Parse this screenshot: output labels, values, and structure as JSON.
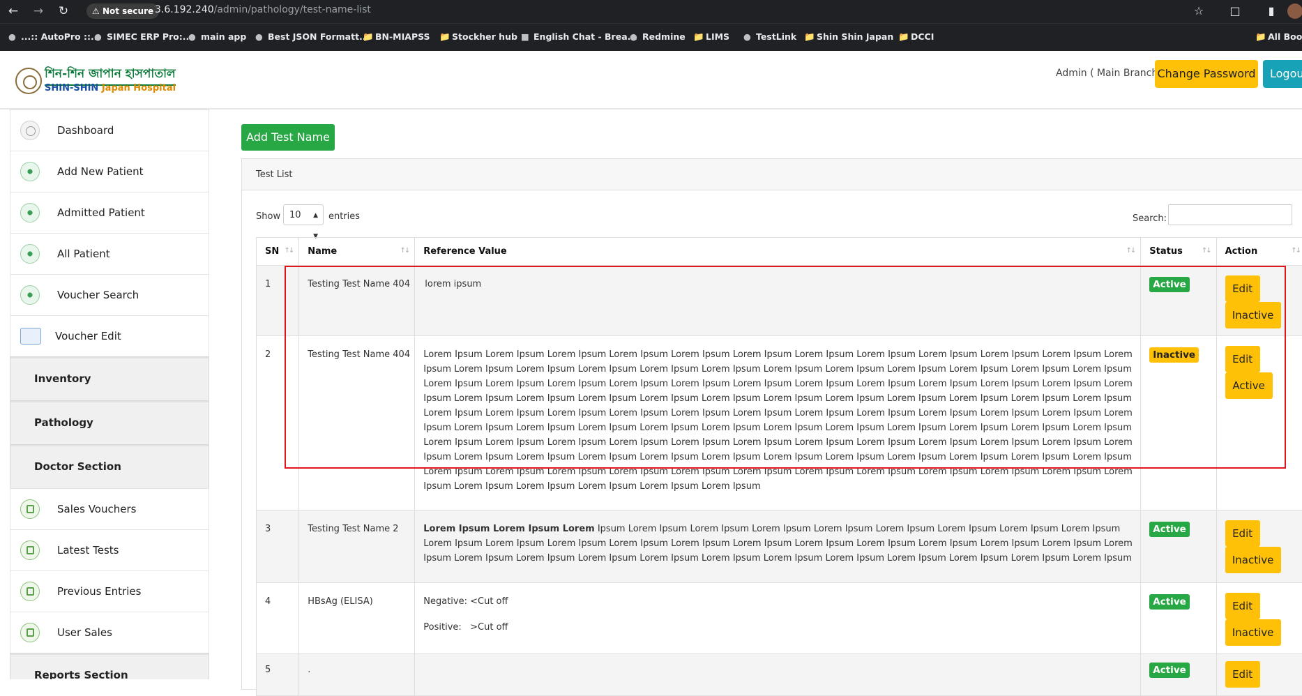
{
  "browser": {
    "secure_chip": "Not secure",
    "url_host": "3.6.192.240",
    "url_path": "/admin/pathology/test-name-list",
    "bookmarks": [
      "...:: AutoPro ::...",
      "SIMEC ERP Pro:...",
      "main app",
      "Best JSON Formatt...",
      "BN-MIAPSS",
      "Stockher hub",
      "English Chat - Brea...",
      "Redmine",
      "LIMS",
      "TestLink",
      "Shin Shin Japan",
      "DCCI",
      "All Boo"
    ]
  },
  "header": {
    "logo_bn": "শিন-শিন জাপান হাসপাতাল",
    "logo_en_a": "SHIN-SHIN ",
    "logo_en_b": "Japan Hospital",
    "admin_label": "Admin ( Main Branch )",
    "change_password": "Change Password",
    "logout": "Logou"
  },
  "sidebar": {
    "items": [
      {
        "label": "Dashboard"
      },
      {
        "label": "Add New Patient"
      },
      {
        "label": "Admitted Patient"
      },
      {
        "label": "All Patient"
      },
      {
        "label": "Voucher Search"
      },
      {
        "label": "Voucher Edit"
      }
    ],
    "sections": [
      "Inventory",
      "Pathology",
      "Doctor Section"
    ],
    "items2": [
      {
        "label": "Sales Vouchers"
      },
      {
        "label": "Latest Tests"
      },
      {
        "label": "Previous Entries"
      },
      {
        "label": "User Sales"
      }
    ],
    "reports": "Reports Section"
  },
  "main": {
    "add_button": "Add Test Name",
    "card_title": "Test List",
    "show": "Show",
    "show_value": "10",
    "entries": "entries",
    "search_label": "Search:",
    "columns": [
      "SN",
      "Name",
      "Reference Value",
      "Status",
      "Action"
    ],
    "rows": [
      {
        "sn": "1",
        "name": "Testing Test Name 404",
        "ref": "lorem ipsum",
        "status": "Active",
        "edit": "Edit",
        "toggle": "Inactive"
      },
      {
        "sn": "2",
        "name": "Testing Test Name 404",
        "ref": "Lorem Ipsum Lorem Ipsum Lorem Ipsum Lorem Ipsum  Lorem Ipsum Lorem Ipsum Lorem Ipsum Lorem Ipsum  Lorem Ipsum Lorem Ipsum Lorem Ipsum Lorem Ipsum  Lorem Ipsum Lorem Ipsum Lorem Ipsum Lorem Ipsum  Lorem Ipsum Lorem Ipsum Lorem Ipsum Lorem Ipsum  Lorem Ipsum Lorem Ipsum Lorem Ipsum Lorem Ipsum  Lorem Ipsum Lorem Ipsum Lorem Ipsum Lorem Ipsum  Lorem Ipsum Lorem Ipsum Lorem Ipsum Lorem Ipsum  Lorem Ipsum Lorem Ipsum Lorem Ipsum Lorem Ipsum  Lorem Ipsum Lorem Ipsum Lorem Ipsum Lorem Ipsum  Lorem Ipsum Lorem Ipsum Lorem Ipsum Lorem Ipsum  Lorem Ipsum Lorem Ipsum Lorem Ipsum Lorem Ipsum  Lorem Ipsum Lorem Ipsum Lorem Ipsum Lorem Ipsum  Lorem Ipsum Lorem Ipsum Lorem Ipsum Lorem Ipsum  Lorem Ipsum Lorem Ipsum Lorem Ipsum Lorem Ipsum  Lorem Ipsum Lorem Ipsum Lorem Ipsum Lorem Ipsum  Lorem Ipsum Lorem Ipsum Lorem Ipsum Lorem Ipsum  Lorem Ipsum Lorem Ipsum Lorem Ipsum Lorem Ipsum  Lorem Ipsum Lorem Ipsum Lorem Ipsum Lorem Ipsum  Lorem Ipsum Lorem Ipsum Lorem Ipsum Lorem Ipsum  Lorem Ipsum Lorem Ipsum Lorem Ipsum Lorem Ipsum  Lorem Ipsum Lorem Ipsum Lorem Ipsum Lorem Ipsum  Lorem Ipsum Lorem Ipsum Lorem Ipsum Lorem Ipsum  Lorem Ipsum Lorem Ipsum Lorem Ipsum Lorem Ipsum  Lorem Ipsum Lorem Ipsum Lorem Ipsum Lorem Ipsum  Lorem Ipsum Lorem Ipsum Lorem Ipsum Lorem Ipsum  Lorem Ipsum Lorem Ipsum Lorem Ipsum Lorem Ipsum  Lorem Ipsum",
        "status": "Inactive",
        "edit": "Edit",
        "toggle": "Active"
      },
      {
        "sn": "3",
        "name": "Testing Test Name 2",
        "ref_bold": "Lorem Ipsum Lorem Ipsum Lorem",
        "ref": " Ipsum Lorem Ipsum Lorem Ipsum Lorem Ipsum Lorem Ipsum Lorem Ipsum Lorem Ipsum Lorem Ipsum Lorem Ipsum Lorem Ipsum Lorem Ipsum Lorem Ipsum Lorem Ipsum Lorem Ipsum Lorem Ipsum Lorem Ipsum Lorem Ipsum Lorem Ipsum Lorem Ipsum Lorem Ipsum Lorem Ipsum Lorem Ipsum Lorem Ipsum Lorem Ipsum Lorem Ipsum Lorem Ipsum Lorem Ipsum Lorem Ipsum Lorem Ipsum Lorem Ipsum Lorem Ipsum Lorem Ipsum",
        "status": "Active",
        "edit": "Edit",
        "toggle": "Inactive"
      },
      {
        "sn": "4",
        "name": "HBsAg (ELISA)",
        "ref_line1": "Negative: <Cut off",
        "ref_line2": "Positive:   >Cut off",
        "status": "Active",
        "edit": "Edit",
        "toggle": "Inactive"
      },
      {
        "sn": "5",
        "name": ".",
        "status": "Active",
        "edit": "Edit"
      }
    ]
  }
}
